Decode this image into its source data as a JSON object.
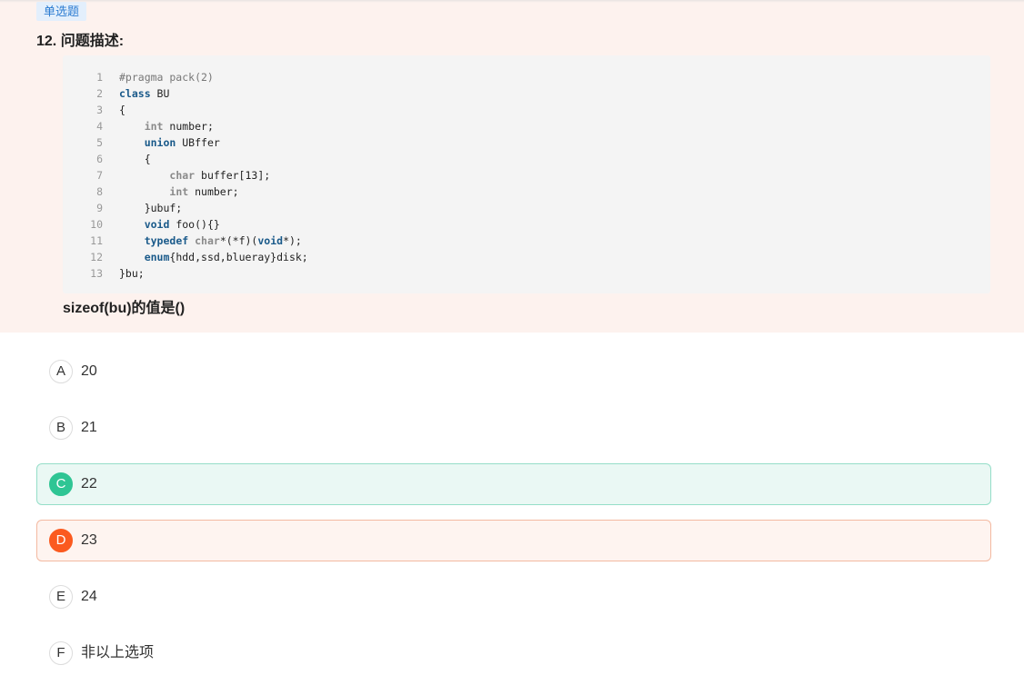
{
  "question": {
    "type_label": "单选题",
    "number_title": "12. 问题描述:",
    "prompt": "sizeof(bu)的值是()"
  },
  "code": {
    "lines": [
      {
        "n": "1",
        "tokens": [
          {
            "t": "#pragma pack(2)",
            "c": "pre"
          }
        ]
      },
      {
        "n": "2",
        "tokens": [
          {
            "t": "class",
            "c": "kw"
          },
          {
            "t": " BU",
            "c": "plain"
          }
        ]
      },
      {
        "n": "3",
        "tokens": [
          {
            "t": "{",
            "c": "plain"
          }
        ]
      },
      {
        "n": "4",
        "tokens": [
          {
            "t": "    ",
            "c": "plain"
          },
          {
            "t": "int",
            "c": "type"
          },
          {
            "t": " number;",
            "c": "plain"
          }
        ]
      },
      {
        "n": "5",
        "tokens": [
          {
            "t": "    ",
            "c": "plain"
          },
          {
            "t": "union",
            "c": "kw"
          },
          {
            "t": " UBffer",
            "c": "plain"
          }
        ]
      },
      {
        "n": "6",
        "tokens": [
          {
            "t": "    {",
            "c": "plain"
          }
        ]
      },
      {
        "n": "7",
        "tokens": [
          {
            "t": "        ",
            "c": "plain"
          },
          {
            "t": "char",
            "c": "type"
          },
          {
            "t": " buffer[13];",
            "c": "plain"
          }
        ]
      },
      {
        "n": "8",
        "tokens": [
          {
            "t": "        ",
            "c": "plain"
          },
          {
            "t": "int",
            "c": "type"
          },
          {
            "t": " number;",
            "c": "plain"
          }
        ]
      },
      {
        "n": "9",
        "tokens": [
          {
            "t": "    }ubuf;",
            "c": "plain"
          }
        ]
      },
      {
        "n": "10",
        "tokens": [
          {
            "t": "    ",
            "c": "plain"
          },
          {
            "t": "void",
            "c": "kw"
          },
          {
            "t": " foo(){}",
            "c": "plain"
          }
        ]
      },
      {
        "n": "11",
        "tokens": [
          {
            "t": "    ",
            "c": "plain"
          },
          {
            "t": "typedef",
            "c": "kw"
          },
          {
            "t": " ",
            "c": "plain"
          },
          {
            "t": "char",
            "c": "type"
          },
          {
            "t": "*(*f)(",
            "c": "plain"
          },
          {
            "t": "void",
            "c": "kw"
          },
          {
            "t": "*);",
            "c": "plain"
          }
        ]
      },
      {
        "n": "12",
        "tokens": [
          {
            "t": "    ",
            "c": "plain"
          },
          {
            "t": "enum",
            "c": "kw"
          },
          {
            "t": "{hdd,ssd,blueray}disk;",
            "c": "plain"
          }
        ]
      },
      {
        "n": "13",
        "tokens": [
          {
            "t": "}bu;",
            "c": "plain"
          }
        ]
      }
    ]
  },
  "options": [
    {
      "letter": "A",
      "text": "20",
      "state": "normal"
    },
    {
      "letter": "B",
      "text": "21",
      "state": "normal"
    },
    {
      "letter": "C",
      "text": "22",
      "state": "correct"
    },
    {
      "letter": "D",
      "text": "23",
      "state": "wrong"
    },
    {
      "letter": "E",
      "text": "24",
      "state": "normal"
    },
    {
      "letter": "F",
      "text": "非以上选项",
      "state": "normal"
    }
  ],
  "colors": {
    "question_bg": "#fdf2ee",
    "correct_accent": "#2fc594",
    "wrong_accent": "#fb5a1f",
    "badge_text": "#2b7bd1"
  }
}
